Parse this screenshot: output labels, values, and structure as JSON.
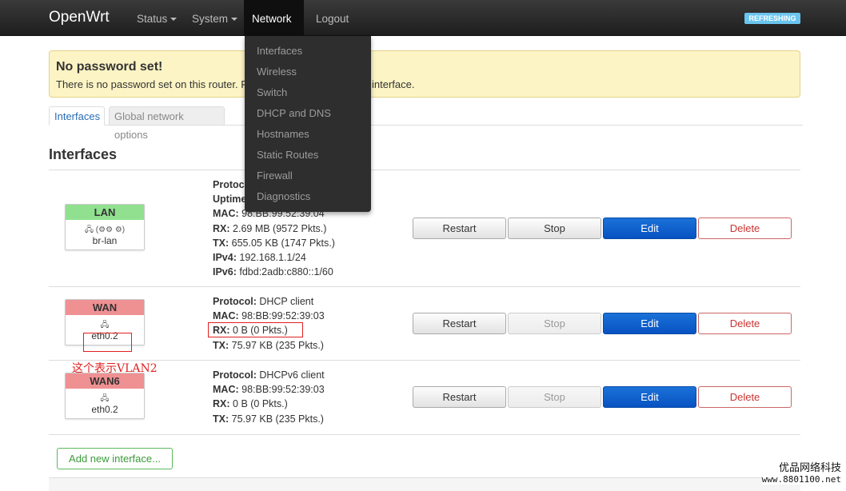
{
  "navbar": {
    "brand": "OpenWrt",
    "menus": [
      "Status",
      "System",
      "Network",
      "Logout"
    ],
    "badge": "REFRESHING"
  },
  "network_dropdown": [
    "Interfaces",
    "Wireless",
    "Switch",
    "DHCP and DNS",
    "Hostnames",
    "Static Routes",
    "Firewall",
    "Diagnostics"
  ],
  "alert": {
    "title": "No password set!",
    "body": "There is no password set on this router. P                                          ssword to protect the web interface."
  },
  "tabs": [
    "Interfaces",
    "Global network options"
  ],
  "section_title": "Interfaces",
  "interfaces": [
    {
      "name": "LAN",
      "device": "br-lan",
      "color": "#90e090",
      "status": [
        {
          "label": "Protoc",
          "value": ""
        },
        {
          "label": "Uptime",
          "value": ""
        },
        {
          "label": "MAC:",
          "value": "98:BB:99:52:39:04"
        },
        {
          "label": "RX:",
          "value": "2.69 MB (9572 Pkts.)"
        },
        {
          "label": "TX:",
          "value": "655.05 KB (1747 Pkts.)"
        },
        {
          "label": "IPv4:",
          "value": "192.168.1.1/24"
        },
        {
          "label": "IPv6:",
          "value": "fdbd:2adb:c880::1/60"
        }
      ],
      "stop_enabled": true
    },
    {
      "name": "WAN",
      "device": "eth0.2",
      "color": "#ef9092",
      "status": [
        {
          "label": "Protocol:",
          "value": "DHCP client"
        },
        {
          "label": "MAC:",
          "value": "98:BB:99:52:39:03"
        },
        {
          "label": "RX:",
          "value": "0 B (0 Pkts.)"
        },
        {
          "label": "TX:",
          "value": "75.97 KB (235 Pkts.)"
        }
      ],
      "stop_enabled": false
    },
    {
      "name": "WAN6",
      "device": "eth0.2",
      "color": "#ef9092",
      "status": [
        {
          "label": "Protocol:",
          "value": "DHCPv6 client"
        },
        {
          "label": "MAC:",
          "value": "98:BB:99:52:39:03"
        },
        {
          "label": "RX:",
          "value": "0 B (0 Pkts.)"
        },
        {
          "label": "TX:",
          "value": "75.97 KB (235 Pkts.)"
        }
      ],
      "stop_enabled": false
    }
  ],
  "buttons": {
    "restart": "Restart",
    "stop": "Stop",
    "edit": "Edit",
    "delete": "Delete"
  },
  "add_interface": "Add new interface...",
  "annotation": "这个表示VLAN2",
  "watermark": {
    "line1": "优品网络科技",
    "line2": "www.8801100.net"
  },
  "colors": {
    "primary": "#0852c2",
    "danger": "#c33",
    "badge": "#6bc5ee",
    "lan": "#90e090",
    "wan": "#ef9092"
  }
}
